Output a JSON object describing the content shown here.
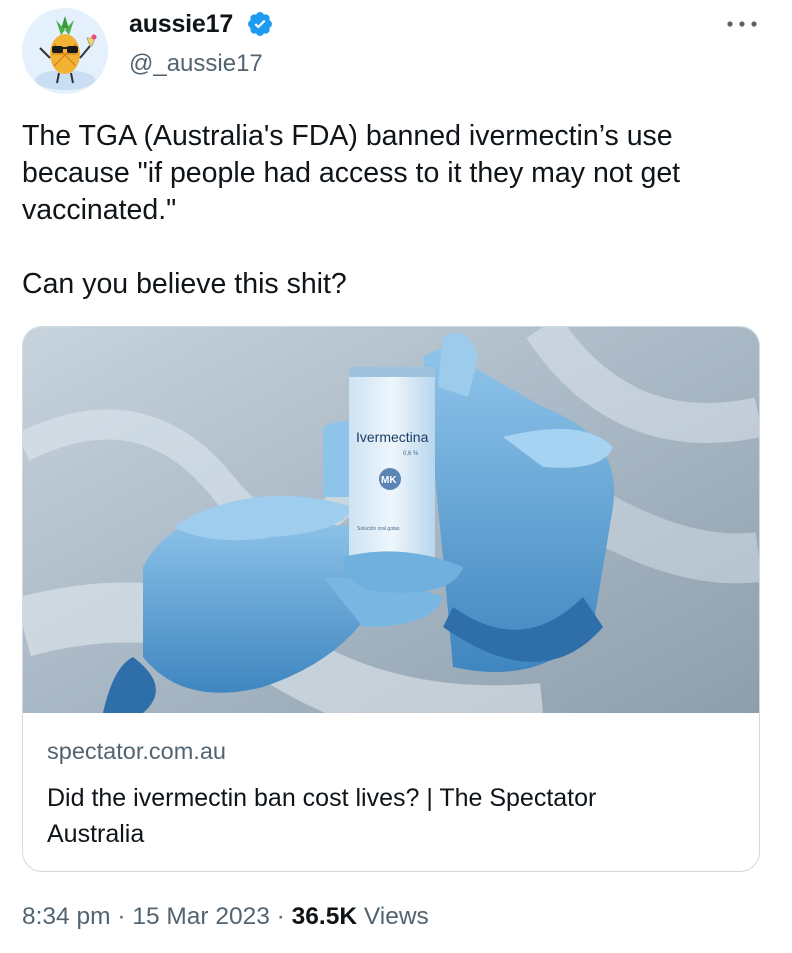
{
  "author": {
    "display_name": "aussie17",
    "handle": "@_aussie17",
    "verified": true,
    "avatar_icon": "pineapple-avatar-icon",
    "verified_icon": "verified-badge-icon",
    "verified_color": "#1d9bf0"
  },
  "more_icon": "more-options-icon",
  "tweet": {
    "text": "The TGA (Australia's FDA) banned ivermectin’s use\nbecause \"if people had access to it they may not get\nvaccinated.\"\n\nCan you believe this shit?"
  },
  "card": {
    "image": {
      "bottle_label": "Ivermectina",
      "bottle_concentration": "0,6 %",
      "bottle_logo": "MK",
      "bottle_subtext": "Solución oral gotas"
    },
    "domain": "spectator.com.au",
    "title": "Did the ivermectin ban cost lives? | The Spectator\nAustralia"
  },
  "meta": {
    "time": "8:34 pm",
    "sep1": " · ",
    "date": "15 Mar 2023",
    "sep2": " · ",
    "views_count": "36.5K",
    "views_label": " Views"
  },
  "colors": {
    "text_primary": "#0f1419",
    "text_secondary": "#536471",
    "card_border": "#cfd9de",
    "glove_blue": "#5aa3d6"
  }
}
